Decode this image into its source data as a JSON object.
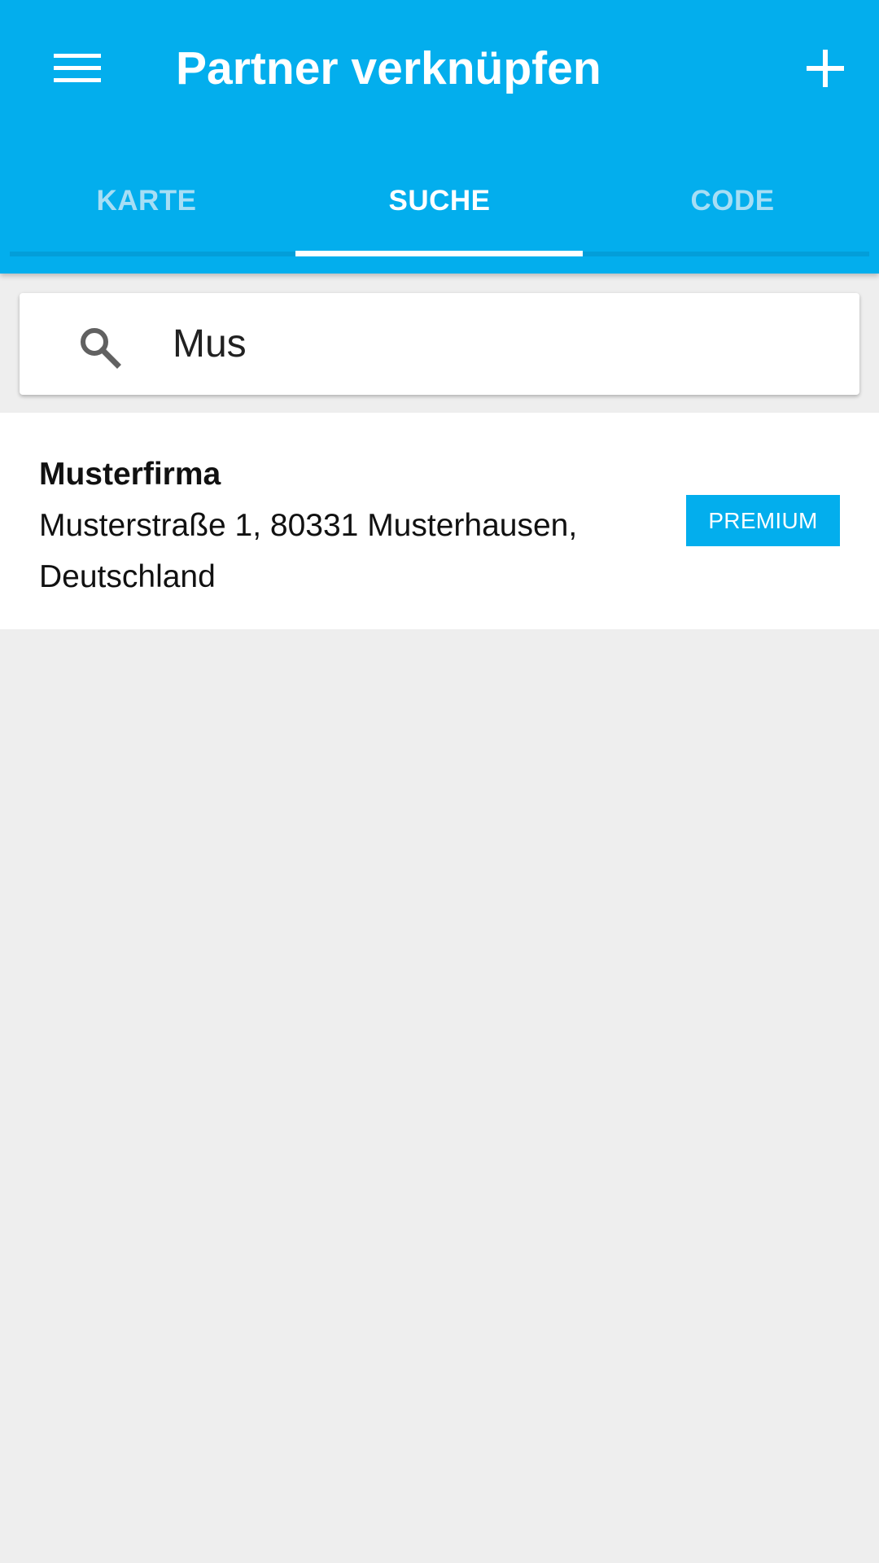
{
  "header": {
    "title": "Partner verknüpfen",
    "menu_icon": "menu-icon",
    "add_icon": "plus-icon"
  },
  "tabs": [
    {
      "label": "KARTE",
      "active": false
    },
    {
      "label": "SUCHE",
      "active": true
    },
    {
      "label": "CODE",
      "active": false
    }
  ],
  "search": {
    "value": "Mus",
    "icon": "search-icon"
  },
  "results": [
    {
      "name": "Musterfirma",
      "address": "Musterstraße 1, 80331 Musterhausen, Deutschland",
      "badge": "PREMIUM"
    }
  ],
  "colors": {
    "primary": "#03aeed",
    "background": "#eeeeee",
    "surface": "#ffffff",
    "tab_inactive_text": "#a6def5"
  }
}
